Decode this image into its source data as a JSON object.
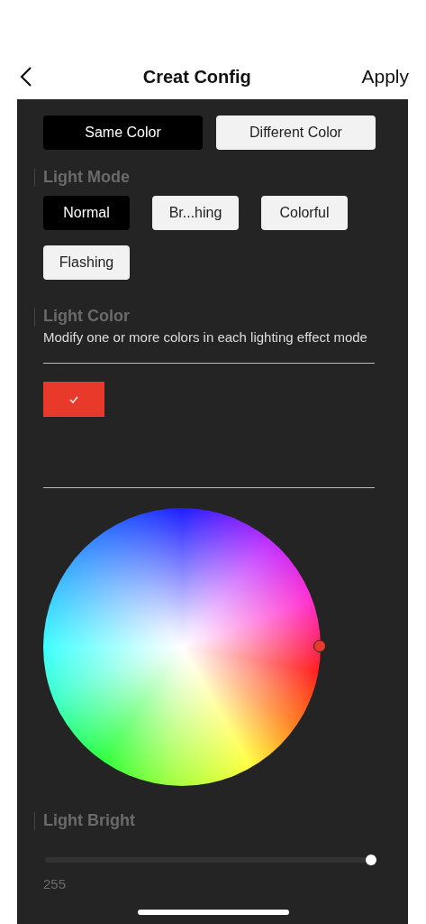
{
  "header": {
    "title": "Creat Config",
    "action": "Apply"
  },
  "color_type": [
    {
      "label": "Same Color",
      "selected": true
    },
    {
      "label": "Different Color",
      "selected": false
    }
  ],
  "light_mode": {
    "title": "Light Mode",
    "options": [
      {
        "label": "Normal",
        "selected": true
      },
      {
        "label": "Br...hing",
        "selected": false
      },
      {
        "label": "Colorful",
        "selected": false
      },
      {
        "label": "Flashing",
        "selected": false
      }
    ]
  },
  "light_color": {
    "title": "Light Color",
    "description": "Modify one or more colors in each lighting effect mode",
    "swatches": [
      {
        "color": "#e8392a",
        "selected": true
      }
    ]
  },
  "light_bright": {
    "title": "Light Bright",
    "level": 1,
    "reading": "255"
  }
}
